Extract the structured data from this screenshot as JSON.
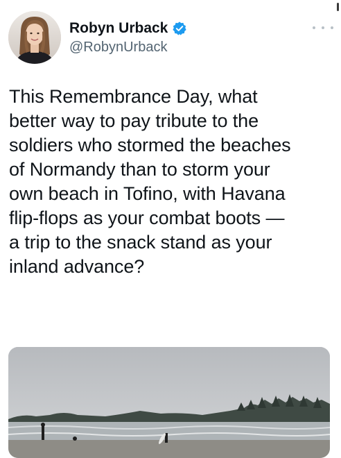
{
  "tweet": {
    "author": {
      "name": "Robyn Urback",
      "handle": "@RobynUrback",
      "verified": true,
      "avatar_icon": "profile-photo"
    },
    "more_icon": "more-options-icon",
    "text": "This Remembrance Day, what\nbetter way to pay tribute to the\nsoldiers who stormed the beaches\nof Normandy than to storm your\nown beach in Tofino, with Havana\nflip-flops as your combat boots —\na trip to the snack stand as your\ninland advance?",
    "media": {
      "type": "photo",
      "description_icon": "beach-photo"
    }
  },
  "colors": {
    "text_primary": "#0f1419",
    "text_secondary": "#536471",
    "verified_blue": "#1d9bf0"
  }
}
